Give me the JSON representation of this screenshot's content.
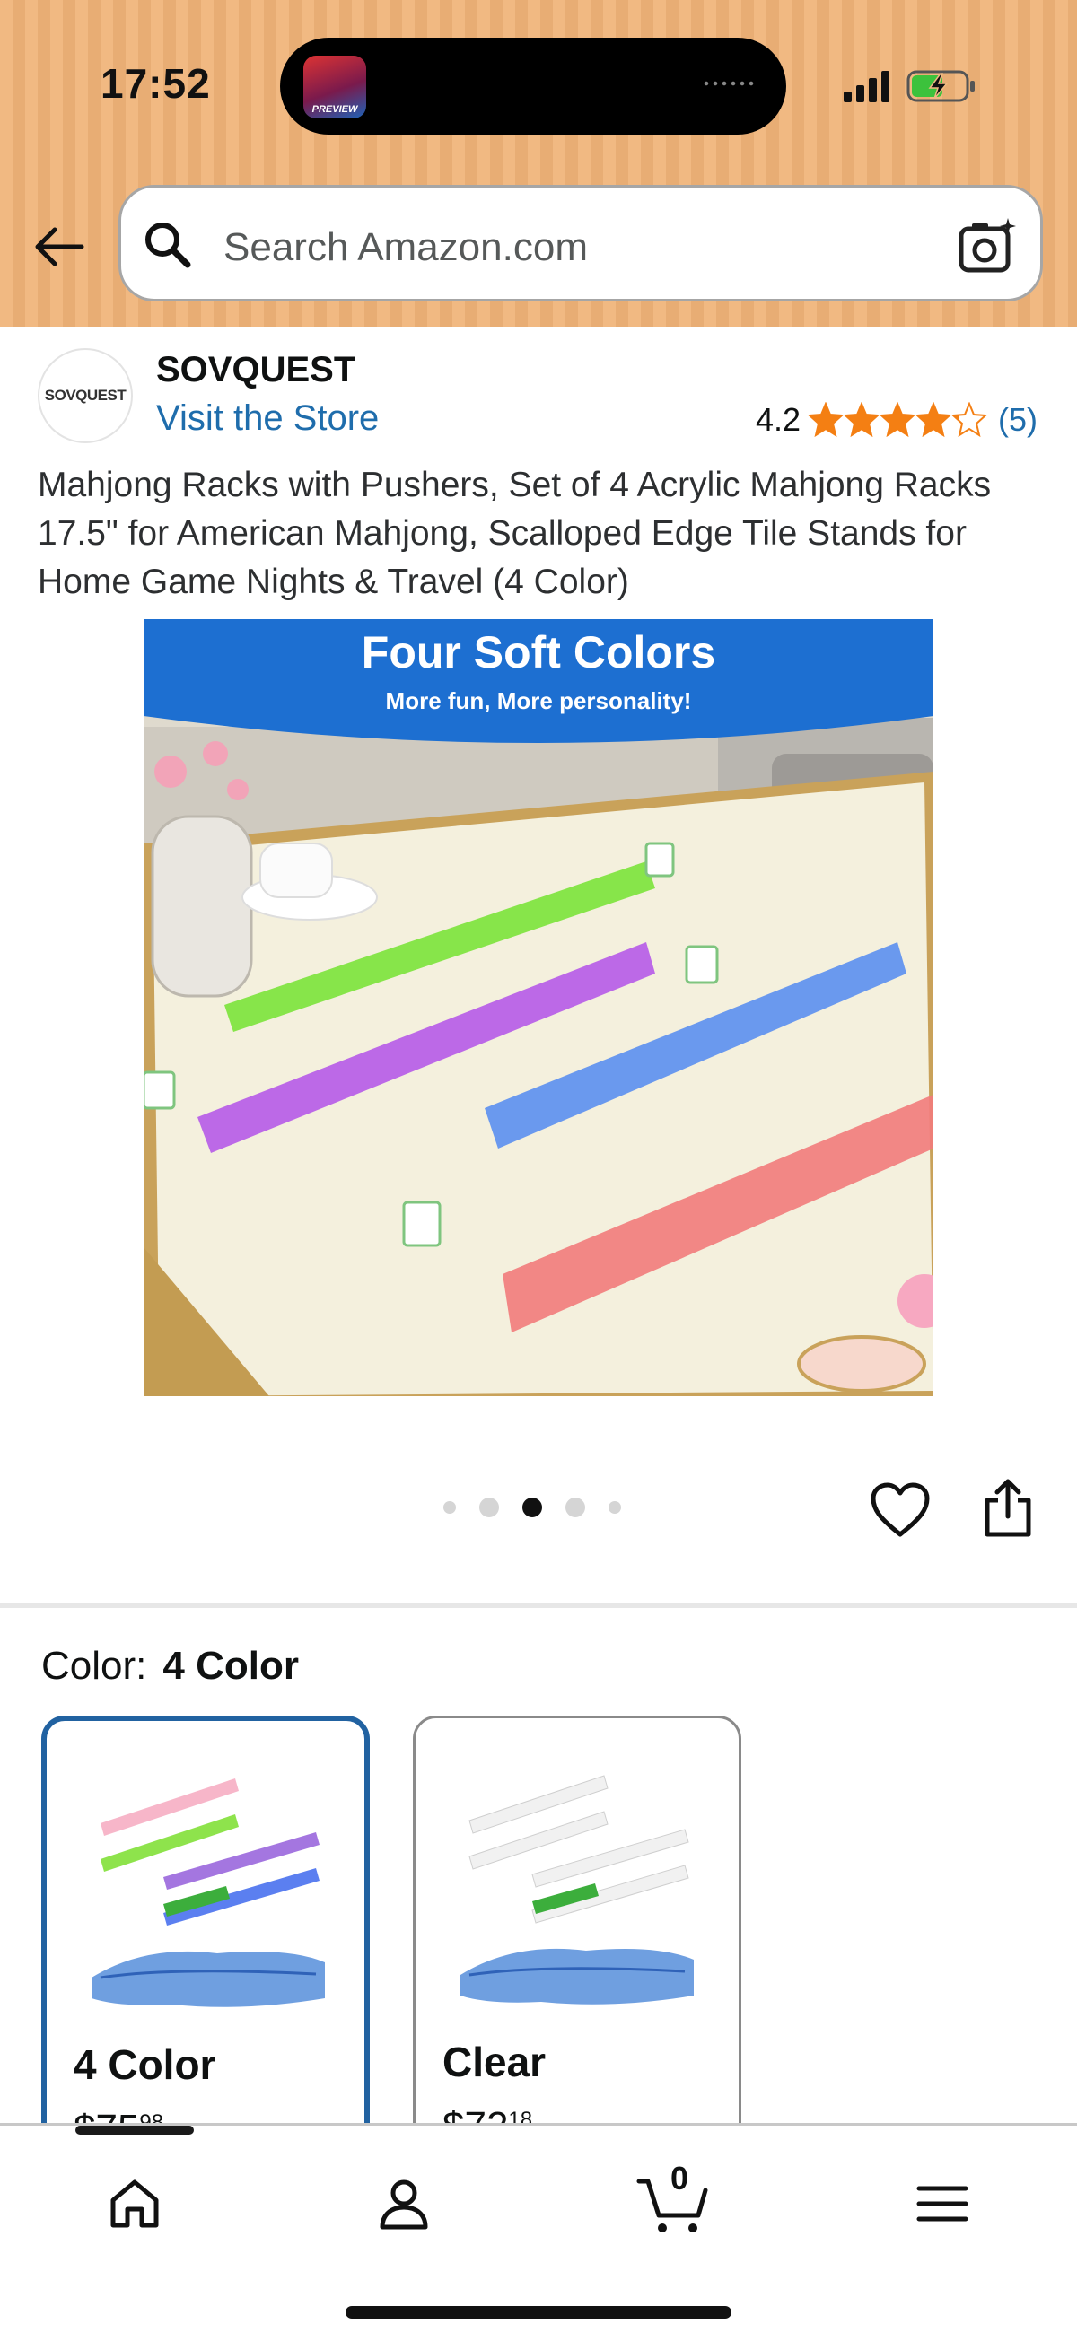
{
  "status_bar": {
    "time": "17:52",
    "island_thumb_label": "PREVIEW",
    "signal_icon": "cellular-signal-icon",
    "battery_icon": "battery-charging-icon"
  },
  "search": {
    "placeholder": "Search Amazon.com"
  },
  "brand": {
    "logo_text": "SOVQUEST",
    "name": "SOVQUEST",
    "visit_store": "Visit the Store"
  },
  "rating": {
    "value": "4.2",
    "stars": 4.2,
    "count": "(5)",
    "star_color": "#f47f13"
  },
  "product": {
    "title": "Mahjong Racks with Pushers, Set of 4 Acrylic Mahjong Racks 17.5\" for American Mahjong, Scalloped Edge Tile Stands for Home Game Nights & Travel (4 Color)"
  },
  "main_image": {
    "banner_title": "Four Soft Colors",
    "banner_subtitle": "More fun, More personality!",
    "banner_color": "#1d6fd1"
  },
  "gallery": {
    "current_index": 3,
    "total": 5
  },
  "color_selection": {
    "label": "Color:",
    "selected_value": "4 Color",
    "options": [
      {
        "name": "4 Color",
        "price_whole": "$75",
        "price_fraction": "98",
        "selected": true
      },
      {
        "name": "Clear",
        "price_whole": "$72",
        "price_fraction": "18",
        "selected": false
      }
    ]
  },
  "bottom_nav": {
    "items": [
      {
        "icon": "home-icon"
      },
      {
        "icon": "account-icon"
      },
      {
        "icon": "cart-icon"
      },
      {
        "icon": "menu-icon"
      }
    ],
    "cart_count": "0"
  },
  "colors": {
    "header_bg": "#f1b982",
    "link": "#1f6dac",
    "selected_border": "#2162a1"
  }
}
